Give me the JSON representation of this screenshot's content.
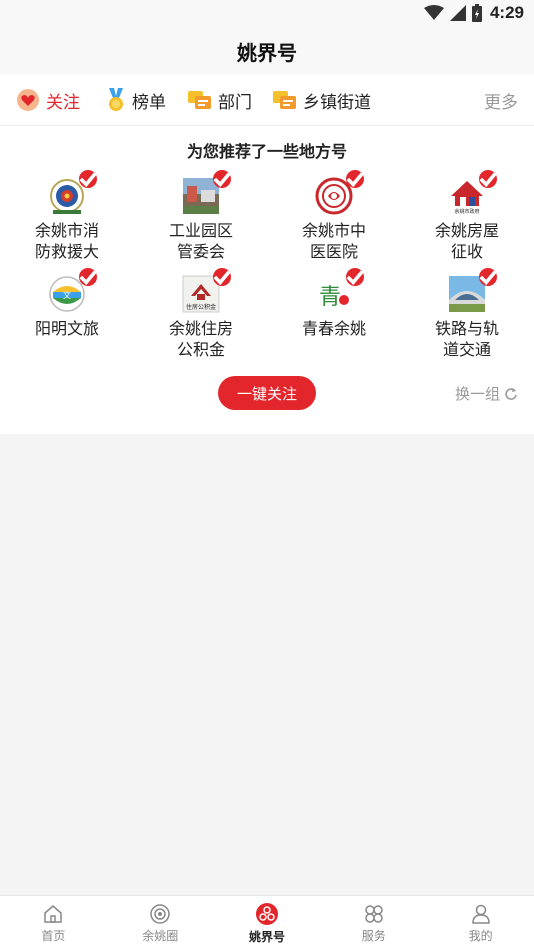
{
  "status_bar": {
    "time": "4:29",
    "icons": [
      "wifi-icon",
      "signal-icon",
      "battery-icon"
    ]
  },
  "header": {
    "title": "姚界号"
  },
  "tabs": [
    {
      "label": "关注",
      "icon": "heart-badge-icon",
      "active": true
    },
    {
      "label": "榜单",
      "icon": "medal-icon",
      "active": false
    },
    {
      "label": "部门",
      "icon": "chat-bubble-icon",
      "active": false
    },
    {
      "label": "乡镇街道",
      "icon": "chat-bubble-icon",
      "active": false
    }
  ],
  "more_label": "更多",
  "recommend": {
    "title": "为您推荐了一些地方号",
    "accounts": [
      {
        "name": "余姚市消防救援大",
        "logo": "fire-rescue-emblem"
      },
      {
        "name": "工业园区管委会",
        "logo": "industrial-park-photo"
      },
      {
        "name": "余姚市中医医院",
        "logo": "hospital-seal"
      },
      {
        "name": "余姚房屋征收",
        "logo": "house-logo",
        "logo_text": "余姚市政府"
      },
      {
        "name": "阳明文旅",
        "logo": "tourism-logo"
      },
      {
        "name": "余姚住房公积金",
        "logo": "housing-fund-logo",
        "logo_text": "住房公积金"
      },
      {
        "name": "青春余姚",
        "logo": "youth-logo",
        "logo_text": "青"
      },
      {
        "name": "铁路与轨道交通",
        "logo": "railway-photo"
      }
    ],
    "follow_all_label": "一键关注",
    "refresh_label": "换一组"
  },
  "bottom_nav": [
    {
      "label": "首页",
      "icon": "home-icon",
      "active": false
    },
    {
      "label": "余姚圈",
      "icon": "circle-target-icon",
      "active": false
    },
    {
      "label": "姚界号",
      "icon": "yaojie-logo-icon",
      "active": true
    },
    {
      "label": "服务",
      "icon": "services-grid-icon",
      "active": false
    },
    {
      "label": "我的",
      "icon": "profile-icon",
      "active": false
    }
  ],
  "colors": {
    "accent": "#e3262c",
    "muted": "#999999"
  }
}
